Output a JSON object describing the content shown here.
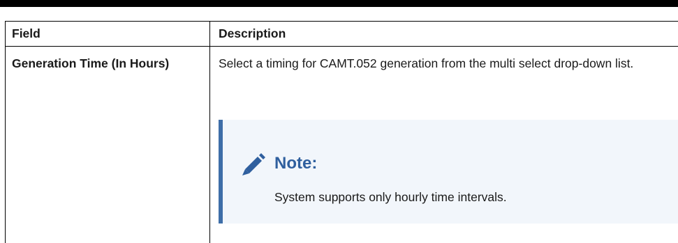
{
  "table": {
    "header": {
      "field": "Field",
      "description": "Description"
    },
    "rows": [
      {
        "field": "Generation Time (In Hours)",
        "description": "Select a timing for CAMT.052 generation from the multi select drop-down list.",
        "note": {
          "icon": "pencil-icon",
          "title": "Note:",
          "body": "System supports only hourly time intervals."
        }
      }
    ]
  },
  "colors": {
    "note_background": "#f2f6fb",
    "note_accent": "#3e6ea8",
    "note_title": "#2f5f9e"
  }
}
